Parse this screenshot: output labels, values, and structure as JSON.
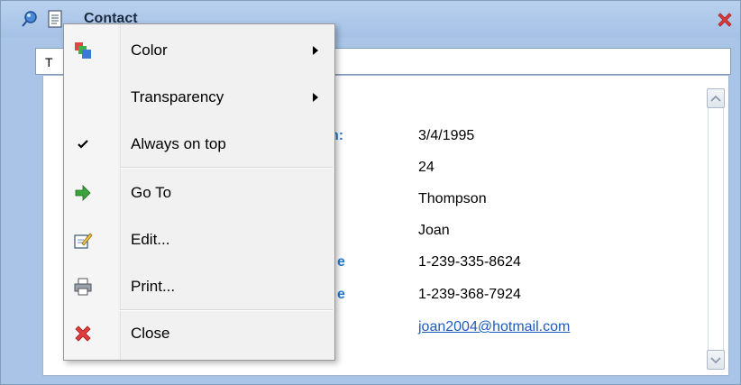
{
  "window": {
    "title": "Contact"
  },
  "tab": {
    "label": "T"
  },
  "fields": [
    {
      "label": "n:",
      "value": "3/4/1995"
    },
    {
      "label": "",
      "value": "24"
    },
    {
      "label": "",
      "value": "Thompson"
    },
    {
      "label": "",
      "value": "Joan"
    },
    {
      "label": "e",
      "value": "1-239-335-8624"
    },
    {
      "label": "e",
      "value": "1-239-368-7924"
    },
    {
      "label": "",
      "value": "joan2004@hotmail.com"
    }
  ],
  "menu": {
    "items": [
      {
        "label": "Color",
        "icon": "color-icon",
        "submenu": true
      },
      {
        "label": "Transparency",
        "icon": "",
        "submenu": true
      },
      {
        "label": "Always on top",
        "icon": "checkmark-icon",
        "checked": true
      },
      {
        "label": "Go To",
        "icon": "arrow-right-icon"
      },
      {
        "label": "Edit...",
        "icon": "edit-icon"
      },
      {
        "label": "Print...",
        "icon": "print-icon"
      },
      {
        "label": "Close",
        "icon": "close-icon"
      }
    ]
  },
  "colors": {
    "title_bar": "#a9c4e7",
    "label_blue": "#2a7acc",
    "link_blue": "#1f5bbf",
    "close_red": "#e23b3b",
    "goto_green": "#3aa33a"
  }
}
